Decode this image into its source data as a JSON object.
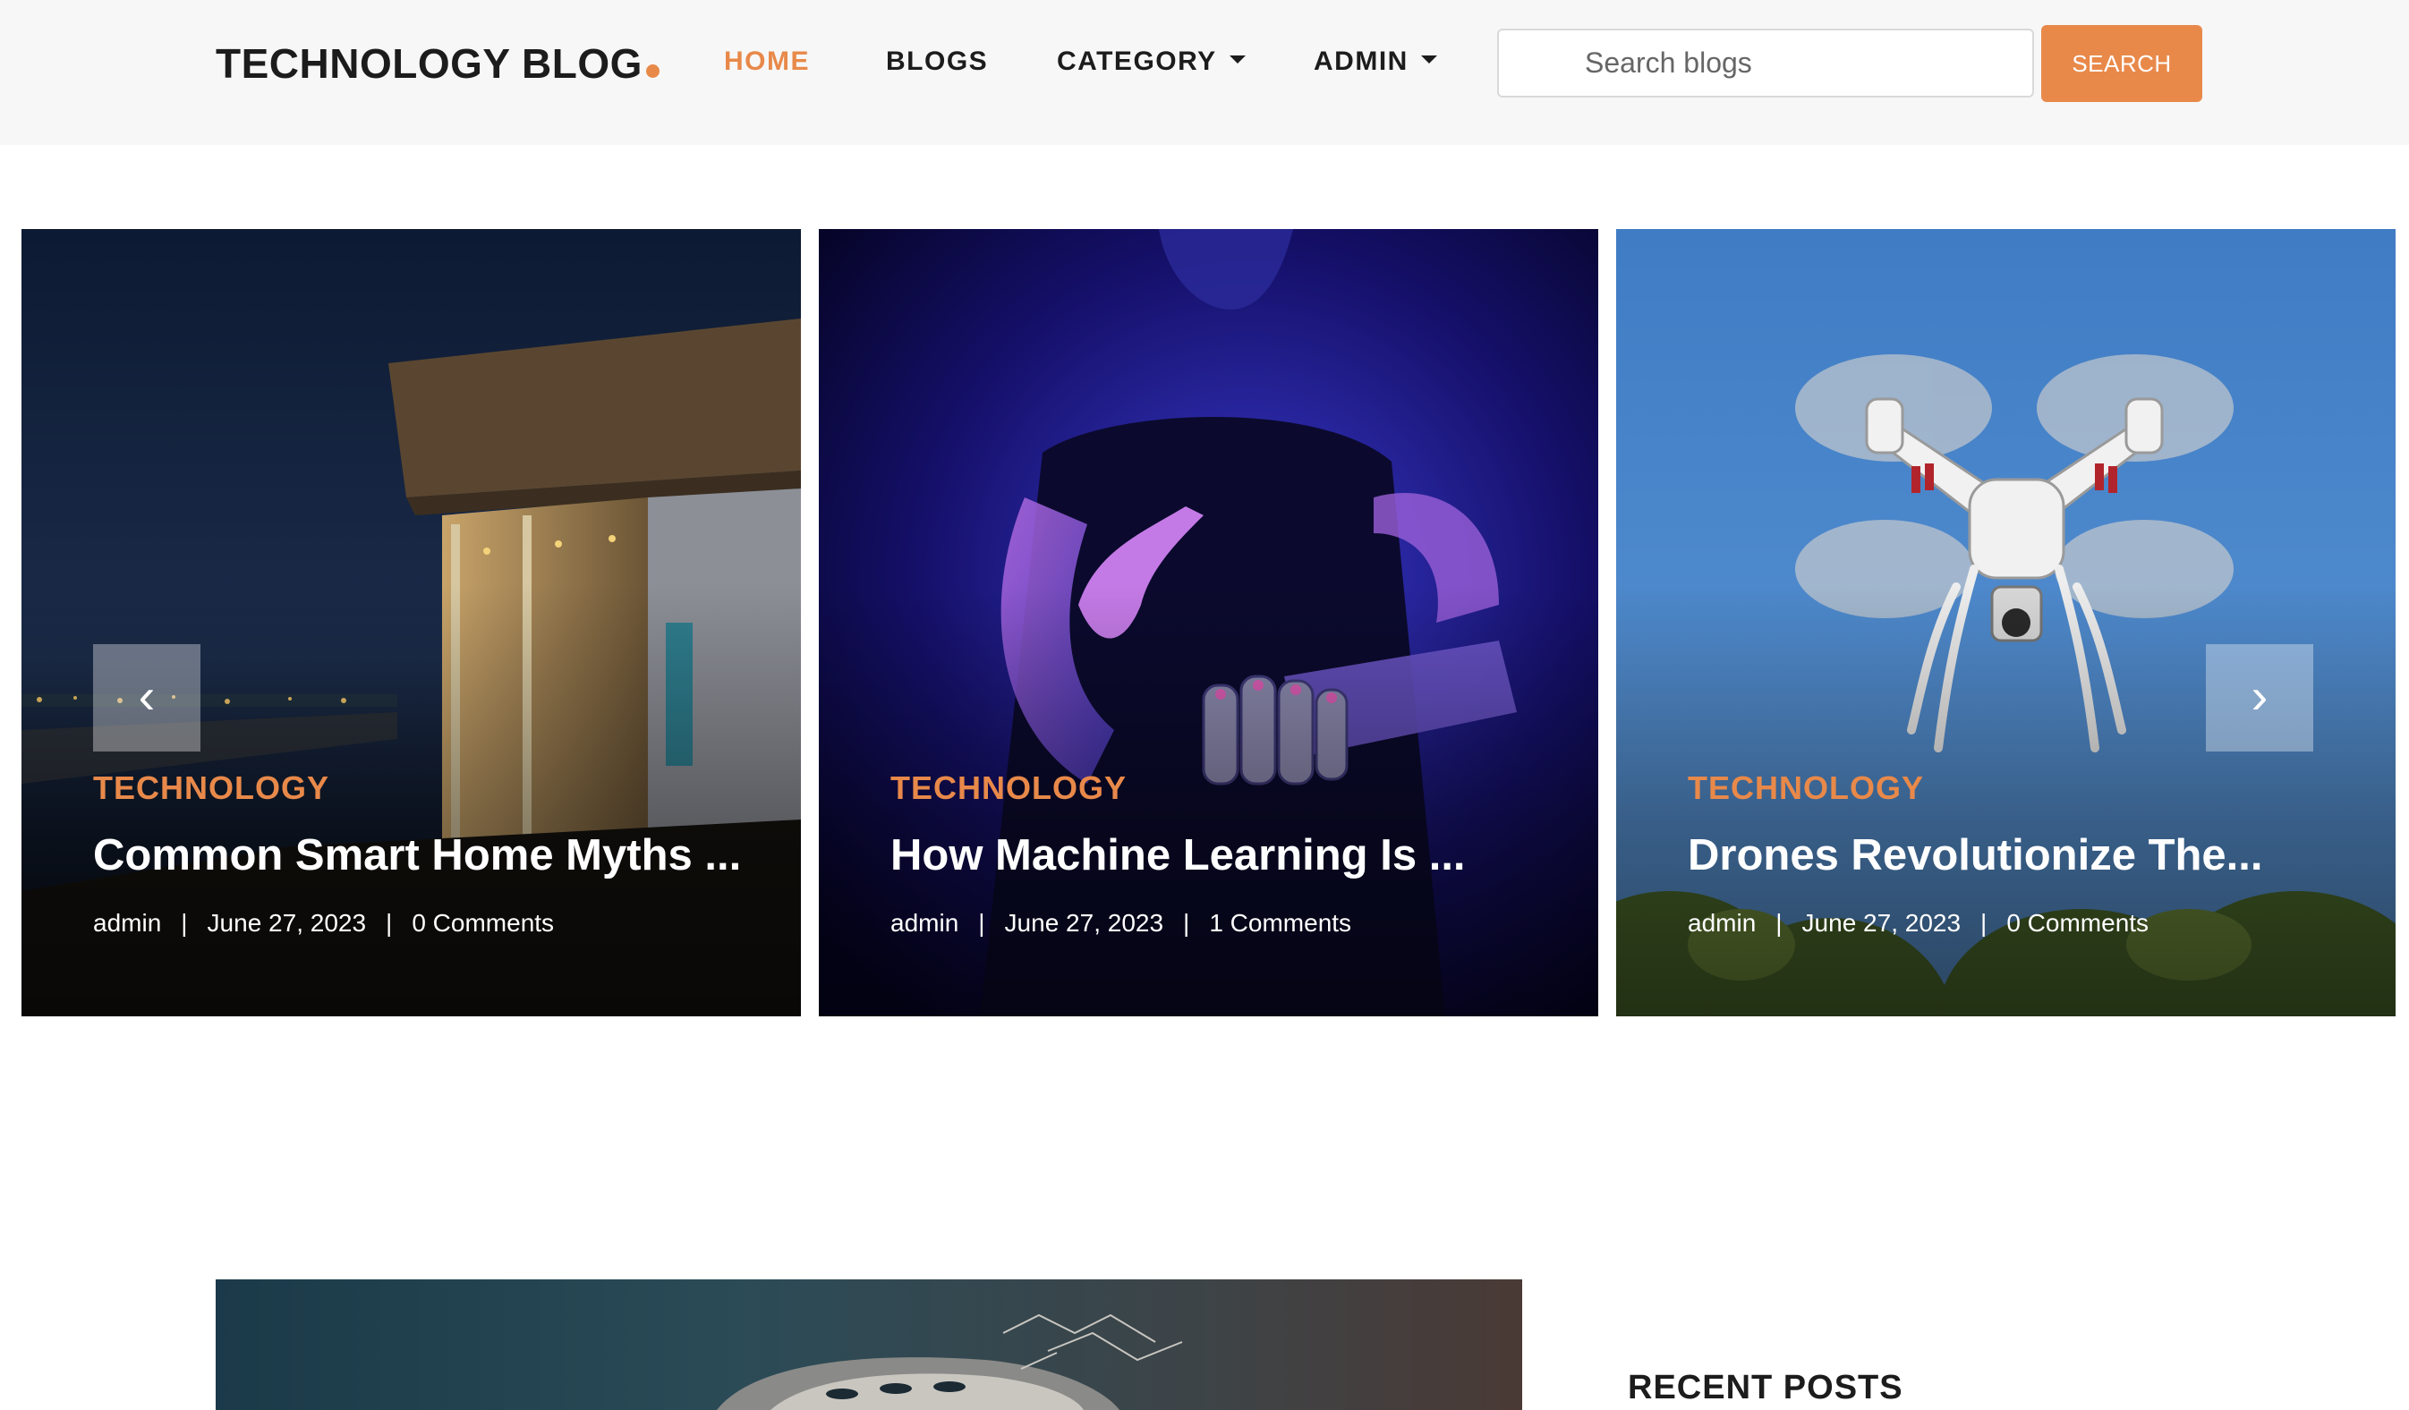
{
  "brand": {
    "name": "TECHNOLOGY BLOG"
  },
  "nav": {
    "home": "HOME",
    "blogs": "BLOGS",
    "category": "CATEGORY",
    "admin": "ADMIN"
  },
  "search": {
    "placeholder": "Search blogs",
    "button_label": "SEARCH"
  },
  "colors": {
    "accent": "#e8894a",
    "header_bg": "#f7f7f7",
    "text_dark": "#1c1c1c"
  },
  "carousel": {
    "prev_icon": "‹",
    "next_icon": "›",
    "posts": [
      {
        "category": "TECHNOLOGY",
        "title": "Common Smart Home Myths ...",
        "author": "admin",
        "date": "June 27, 2023",
        "comments": "0 Comments"
      },
      {
        "category": "TECHNOLOGY",
        "title": "How Machine Learning Is ...",
        "author": "admin",
        "date": "June 27, 2023",
        "comments": "1 Comments"
      },
      {
        "category": "TECHNOLOGY",
        "title": "Drones Revolutionize The...",
        "author": "admin",
        "date": "June 27, 2023",
        "comments": "0 Comments"
      }
    ]
  },
  "sidebar": {
    "recent_posts_title": "RECENT POSTS"
  }
}
